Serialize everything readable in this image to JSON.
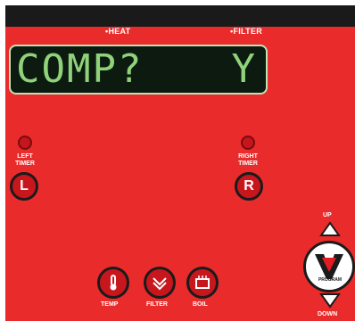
{
  "indicators": {
    "heat": "HEAT",
    "filter": "FILTER"
  },
  "display": {
    "left": "COMP?",
    "right": "Y"
  },
  "timers": {
    "left": {
      "label_line1": "LEFT",
      "label_line2": "TIMER",
      "button": "L"
    },
    "right": {
      "label_line1": "RIGHT",
      "label_line2": "TIMER",
      "button": "R"
    }
  },
  "functions": {
    "temp": "TEMP",
    "filter": "FILTER",
    "boil": "BOIL"
  },
  "nav": {
    "up": "UP",
    "down": "DOWN",
    "program": "PROGRAM"
  },
  "colors": {
    "panel": "#ea2b2b",
    "lcd_text": "#8fd27a",
    "lcd_bg": "#0c1a10"
  }
}
